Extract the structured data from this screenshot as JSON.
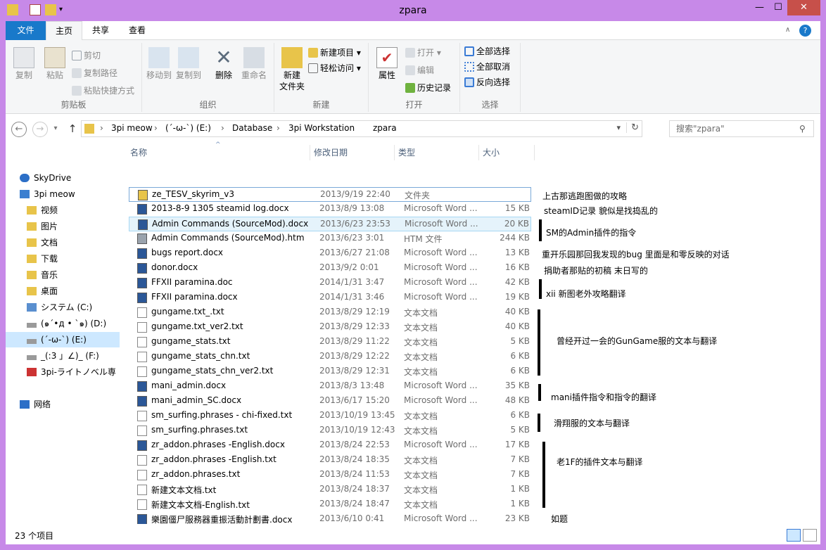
{
  "window": {
    "title": "zpara",
    "minimize": "—",
    "maximize": "☐",
    "close": "✕"
  },
  "tabs": [
    {
      "label": "文件"
    },
    {
      "label": "主页"
    },
    {
      "label": "共享"
    },
    {
      "label": "查看"
    }
  ],
  "ribbon": {
    "clipboard": {
      "group": "剪贴板",
      "copy": "复制",
      "paste": "粘贴",
      "cut": "剪切",
      "copy_path": "复制路径",
      "paste_shortcut": "粘贴快捷方式"
    },
    "organize": {
      "group": "组织",
      "move_to": "移动到",
      "copy_to": "复制到",
      "delete": "删除",
      "rename": "重命名"
    },
    "new": {
      "group": "新建",
      "new_folder": "新建\n文件夹",
      "new_item": "新建项目 ▾",
      "easy_access": "轻松访问 ▾"
    },
    "open": {
      "group": "打开",
      "properties": "属性",
      "open": "打开 ▾",
      "edit": "编辑",
      "history": "历史记录"
    },
    "select": {
      "group": "选择",
      "select_all": "全部选择",
      "select_none": "全部取消",
      "invert": "反向选择"
    }
  },
  "address": {
    "crumbs": [
      "3pi meow",
      "(´-ω-`) (E:)",
      "Database",
      "3pi Workstation",
      "zpara"
    ],
    "separators": [
      "›",
      "›",
      "›",
      "›"
    ],
    "search_placeholder": "搜索\"zpara\""
  },
  "sidebar": {
    "items": [
      {
        "label": "SkyDrive",
        "icon": "cloud-icon"
      },
      {
        "label": "3pi meow",
        "icon": "computer-icon"
      },
      {
        "label": "视频",
        "icon": "folder-icon"
      },
      {
        "label": "图片",
        "icon": "folder-icon"
      },
      {
        "label": "文档",
        "icon": "folder-icon"
      },
      {
        "label": "下载",
        "icon": "folder-icon"
      },
      {
        "label": "音乐",
        "icon": "folder-icon"
      },
      {
        "label": "桌面",
        "icon": "folder-icon"
      },
      {
        "label": "システム (C:)",
        "icon": "drive-icon"
      },
      {
        "label": "(๑´•д • `๑) (D:)",
        "icon": "drive-icon"
      },
      {
        "label": "(´-ω-`) (E:)",
        "icon": "drive-icon"
      },
      {
        "label": "_(:3 」∠)_ (F:)",
        "icon": "drive-icon"
      },
      {
        "label": "3pi-ライトノベル専",
        "icon": "sd-card-icon"
      },
      {
        "label": "网络",
        "icon": "network-icon"
      }
    ]
  },
  "columns": {
    "name": "名称",
    "date": "修改日期",
    "type": "类型",
    "size": "大小"
  },
  "files": [
    {
      "name": "ze_TESV_skyrim_v3",
      "date": "2013/9/19 22:40",
      "type": "文件夹",
      "size": "",
      "kind": "folder"
    },
    {
      "name": "2013-8-9 1305 steamid log.docx",
      "date": "2013/8/9 13:08",
      "type": "Microsoft Word ...",
      "size": "15 KB",
      "kind": "word"
    },
    {
      "name": "Admin Commands (SourceMod).docx",
      "date": "2013/6/23 23:53",
      "type": "Microsoft Word ...",
      "size": "20 KB",
      "kind": "word"
    },
    {
      "name": "Admin Commands (SourceMod).htm",
      "date": "2013/6/23 3:01",
      "type": "HTM 文件",
      "size": "244 KB",
      "kind": "htm"
    },
    {
      "name": "bugs report.docx",
      "date": "2013/6/27 21:08",
      "type": "Microsoft Word ...",
      "size": "13 KB",
      "kind": "word"
    },
    {
      "name": "donor.docx",
      "date": "2013/9/2 0:01",
      "type": "Microsoft Word ...",
      "size": "16 KB",
      "kind": "word"
    },
    {
      "name": "FFXII paramina.doc",
      "date": "2014/1/31 3:47",
      "type": "Microsoft Word ...",
      "size": "42 KB",
      "kind": "word"
    },
    {
      "name": "FFXII paramina.docx",
      "date": "2014/1/31 3:46",
      "type": "Microsoft Word ...",
      "size": "19 KB",
      "kind": "word"
    },
    {
      "name": "gungame.txt_.txt",
      "date": "2013/8/29 12:19",
      "type": "文本文档",
      "size": "40 KB",
      "kind": "txt"
    },
    {
      "name": "gungame.txt_ver2.txt",
      "date": "2013/8/29 12:33",
      "type": "文本文档",
      "size": "40 KB",
      "kind": "txt"
    },
    {
      "name": "gungame_stats.txt",
      "date": "2013/8/29 11:22",
      "type": "文本文档",
      "size": "5 KB",
      "kind": "txt"
    },
    {
      "name": "gungame_stats_chn.txt",
      "date": "2013/8/29 12:22",
      "type": "文本文档",
      "size": "6 KB",
      "kind": "txt"
    },
    {
      "name": "gungame_stats_chn_ver2.txt",
      "date": "2013/8/29 12:31",
      "type": "文本文档",
      "size": "6 KB",
      "kind": "txt"
    },
    {
      "name": "mani_admin.docx",
      "date": "2013/8/3 13:48",
      "type": "Microsoft Word ...",
      "size": "35 KB",
      "kind": "word"
    },
    {
      "name": "mani_admin_SC.docx",
      "date": "2013/6/17 15:20",
      "type": "Microsoft Word ...",
      "size": "48 KB",
      "kind": "word"
    },
    {
      "name": "sm_surfing.phrases - chi-fixed.txt",
      "date": "2013/10/19 13:45",
      "type": "文本文档",
      "size": "6 KB",
      "kind": "txt"
    },
    {
      "name": "sm_surfing.phrases.txt",
      "date": "2013/10/19 12:43",
      "type": "文本文档",
      "size": "5 KB",
      "kind": "txt"
    },
    {
      "name": "zr_addon.phrases -English.docx",
      "date": "2013/8/24 22:53",
      "type": "Microsoft Word ...",
      "size": "17 KB",
      "kind": "word"
    },
    {
      "name": "zr_addon.phrases -English.txt",
      "date": "2013/8/24 18:35",
      "type": "文本文档",
      "size": "7 KB",
      "kind": "txt"
    },
    {
      "name": "zr_addon.phrases.txt",
      "date": "2013/8/24 11:53",
      "type": "文本文档",
      "size": "7 KB",
      "kind": "txt"
    },
    {
      "name": "新建文本文档.txt",
      "date": "2013/8/24 18:37",
      "type": "文本文档",
      "size": "1 KB",
      "kind": "txt"
    },
    {
      "name": "新建文本文档-English.txt",
      "date": "2013/8/24 18:47",
      "type": "文本文档",
      "size": "1 KB",
      "kind": "txt"
    },
    {
      "name": "樂園僵尸服務器重振活動計劃書.docx",
      "date": "2013/6/10 0:41",
      "type": "Microsoft Word ...",
      "size": "23 KB",
      "kind": "word"
    }
  ],
  "notes": [
    "上古那逃跑图做的攻略",
    "steamID记录 貌似是找捣乱的",
    "SM的Admin插件的指令",
    "重开乐园那回我发现的bug 里面是和零反映的对话",
    "捐助者那贴的初稿 末日写的",
    "xii 新图老外攻略翻译",
    "曾经开过一会的GunGame服的文本与翻译",
    "mani插件指令和指令的翻译",
    "滑翔服的文本与翻译",
    "老1F的插件文本与翻译",
    "如题"
  ],
  "status": {
    "count": "23 个项目"
  }
}
